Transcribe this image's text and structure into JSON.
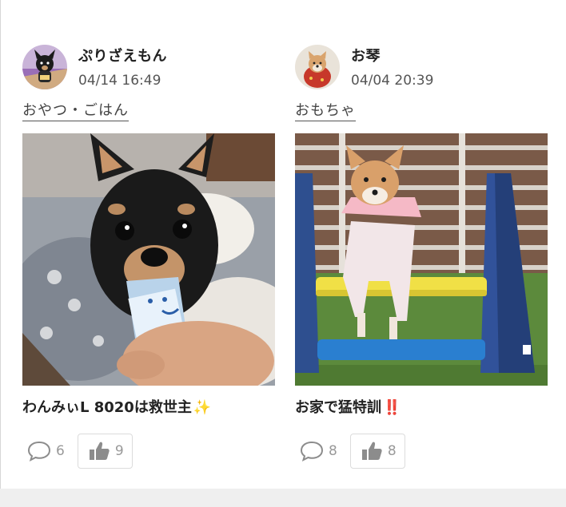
{
  "posts": [
    {
      "username": "ぷりざえもん",
      "date": "04/14 16:49",
      "category": "おやつ・ごはん",
      "title": "わんみぃL 8020は救世主",
      "title_emoji": "✨",
      "comment_count": "6",
      "like_count": "9",
      "avatar_icon": "black-chihuahua-avatar",
      "photo_desc_icon": "chihuahua-eating-treat-photo"
    },
    {
      "username": "お琴",
      "date": "04/04 20:39",
      "category": "おもちゃ",
      "title": "お家で猛特訓",
      "title_emoji": "‼️",
      "comment_count": "8",
      "like_count": "8",
      "avatar_icon": "shiba-avatar",
      "photo_desc_icon": "shiba-agility-jump-photo"
    }
  ],
  "colors": {
    "text": "#222222",
    "muted": "#999999",
    "border": "#dcdcdc",
    "icon_gray": "#8c8c8c"
  },
  "icons": {
    "comment": "comment-bubble-icon",
    "like": "thumbs-up-icon"
  }
}
